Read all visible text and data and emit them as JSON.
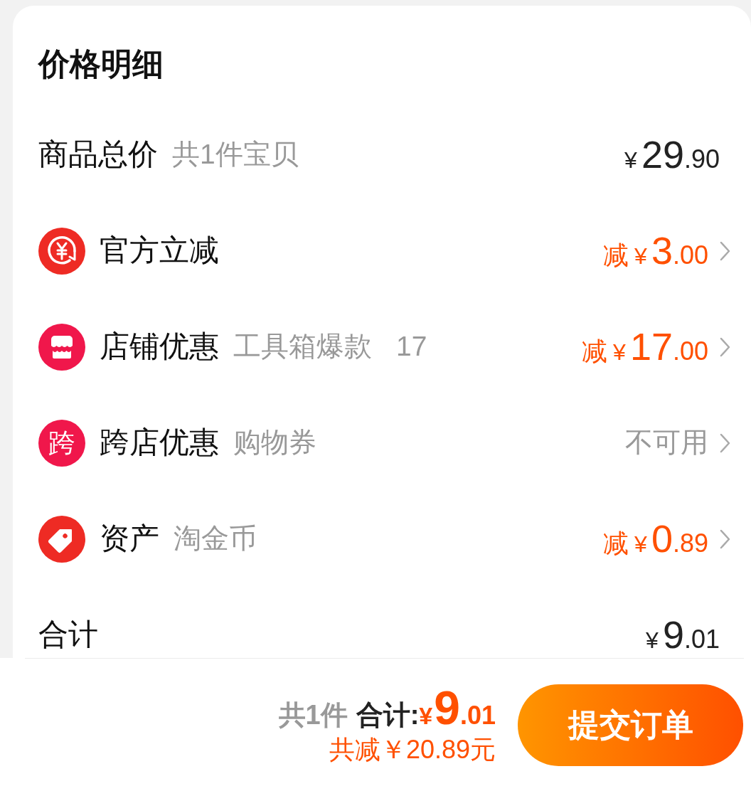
{
  "details": {
    "title": "价格明细",
    "subtotal": {
      "label": "商品总价",
      "note": "共1件宝贝",
      "currency": "¥",
      "integer": "29",
      "decimal": ".90"
    },
    "adjustments": [
      {
        "kind": "official",
        "label": "官方立减",
        "value": {
          "kind": "discount",
          "prefix": "减",
          "currency": "¥",
          "integer": "3",
          "decimal": ".00"
        }
      },
      {
        "kind": "store",
        "label": "店铺优惠",
        "note": "工具箱爆款",
        "count": "17",
        "value": {
          "kind": "discount",
          "prefix": "减",
          "currency": "¥",
          "integer": "17",
          "decimal": ".00"
        }
      },
      {
        "kind": "cross_store",
        "badge": "跨",
        "label": "跨店优惠",
        "note": "购物券",
        "value": {
          "kind": "status",
          "text": "不可用"
        }
      },
      {
        "kind": "asset",
        "label": "资产",
        "note": "淘金币",
        "value": {
          "kind": "discount",
          "prefix": "减",
          "currency": "¥",
          "integer": "0",
          "decimal": ".89"
        }
      }
    ],
    "total": {
      "label": "合计",
      "currency": "¥",
      "integer": "9",
      "decimal": ".01"
    }
  },
  "checkout_bar": {
    "item_count": "共1件",
    "total_label": "合计:",
    "currency": "¥",
    "integer": "9",
    "decimal": ".01",
    "savings": "共减￥20.89元",
    "submit_button": "提交订单"
  }
}
